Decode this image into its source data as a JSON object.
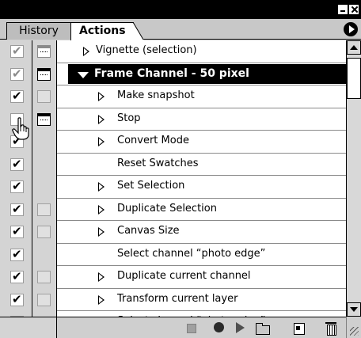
{
  "window": {
    "minimize_label": "Minimize",
    "close_label": "Close"
  },
  "tabs": [
    {
      "label": "History",
      "active": false
    },
    {
      "label": "Actions",
      "active": true
    }
  ],
  "actions": [
    {
      "label": "Vignette (selection)",
      "type": "action",
      "expanded": false,
      "checked": true,
      "check_dim": true,
      "dialog": "icon",
      "dialog_dim": true
    },
    {
      "label": "Frame Channel - 50 pixel",
      "type": "action-selected",
      "expanded": true,
      "checked": true,
      "check_dim": true,
      "dialog": "icon",
      "dialog_dim": false
    },
    {
      "label": "Make snapshot",
      "type": "step",
      "expandable": true,
      "checked": true,
      "dialog": "empty"
    },
    {
      "label": "Stop",
      "type": "step",
      "expandable": true,
      "checked": false,
      "dialog": "icon"
    },
    {
      "label": "Convert Mode",
      "type": "step",
      "expandable": true,
      "checked": true,
      "dialog": "none"
    },
    {
      "label": "Reset Swatches",
      "type": "step",
      "expandable": false,
      "checked": true,
      "dialog": "none"
    },
    {
      "label": "Set Selection",
      "type": "step",
      "expandable": true,
      "checked": true,
      "dialog": "none"
    },
    {
      "label": "Duplicate Selection",
      "type": "step",
      "expandable": true,
      "checked": true,
      "dialog": "empty"
    },
    {
      "label": "Canvas Size",
      "type": "step",
      "expandable": true,
      "checked": true,
      "dialog": "empty"
    },
    {
      "label": "Select channel “photo edge”",
      "type": "step",
      "expandable": false,
      "checked": true,
      "dialog": "none"
    },
    {
      "label": "Duplicate current channel",
      "type": "step",
      "expandable": true,
      "checked": true,
      "dialog": "empty"
    },
    {
      "label": "Transform current layer",
      "type": "step",
      "expandable": true,
      "checked": true,
      "dialog": "empty"
    },
    {
      "label": "Select channel “photo edge”",
      "type": "step",
      "expandable": false,
      "checked": true,
      "dialog": "none"
    }
  ],
  "toolbar": {
    "buttons": [
      "stop-icon",
      "record-icon",
      "play-icon",
      "folder-icon",
      "new-action-icon",
      "trash-icon"
    ]
  },
  "colors": {
    "selected_bg": "#000000",
    "panel_bg": "#d0d0d0",
    "list_bg": "#ffffff"
  }
}
